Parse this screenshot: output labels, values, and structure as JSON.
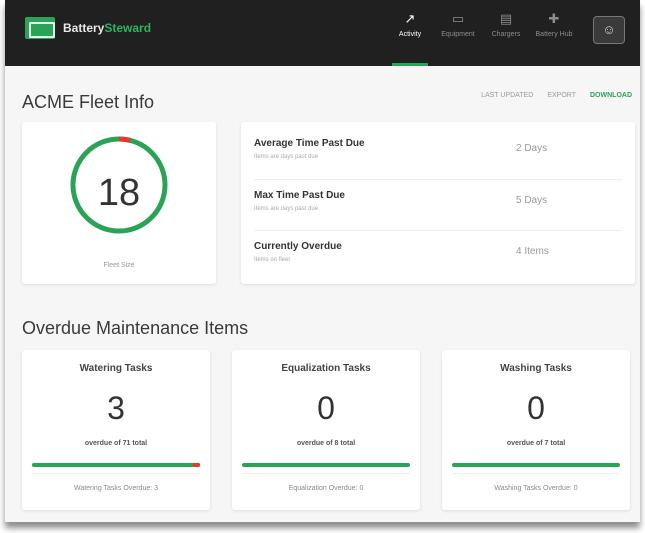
{
  "app": {
    "brand_main": "Battery",
    "brand_accent": "Steward"
  },
  "nav": [
    {
      "label": "Activity",
      "icon": "activity-icon",
      "glyph": "↗",
      "active": true
    },
    {
      "label": "Equipment",
      "icon": "battery-icon",
      "glyph": "▭",
      "active": false
    },
    {
      "label": "Chargers",
      "icon": "charger-icon",
      "glyph": "▤",
      "active": false
    },
    {
      "label": "Battery Hub",
      "icon": "hub-icon",
      "glyph": "✚",
      "active": false
    }
  ],
  "user": {
    "avatar_glyph": "☺"
  },
  "fleet": {
    "title": "ACME Fleet Info",
    "actions": {
      "first": "LAST UPDATED",
      "export": "EXPORT",
      "download": "DOWNLOAD"
    },
    "ring": {
      "value": "18",
      "caption": "Fleet Size",
      "overdue_fraction": 0.04
    },
    "stats": [
      {
        "title": "Average Time Past Due",
        "sub": "Items are days past due",
        "value": "2 Days"
      },
      {
        "title": "Max Time Past Due",
        "sub": "Items are days past due",
        "value": "5 Days"
      },
      {
        "title": "Currently Overdue",
        "sub": "Items on fleet",
        "value": "4 Items"
      }
    ]
  },
  "overdue": {
    "title": "Overdue Maintenance Items",
    "tasks": [
      {
        "title": "Watering Tasks",
        "count": "3",
        "sub": "overdue of 71 total",
        "link": "Watering Tasks Overdue: 3",
        "overdue_fraction": 0.04
      },
      {
        "title": "Equalization Tasks",
        "count": "0",
        "sub": "overdue of 8 total",
        "link": "Equalization Overdue: 0",
        "overdue_fraction": 0
      },
      {
        "title": "Washing Tasks",
        "count": "0",
        "sub": "overdue of 7 total",
        "link": "Washing Tasks Overdue: 0",
        "overdue_fraction": 0
      }
    ]
  },
  "colors": {
    "accent": "#2aa356",
    "overdue": "#e8392a",
    "track": "#e0e0e0",
    "topbar": "#202020"
  }
}
